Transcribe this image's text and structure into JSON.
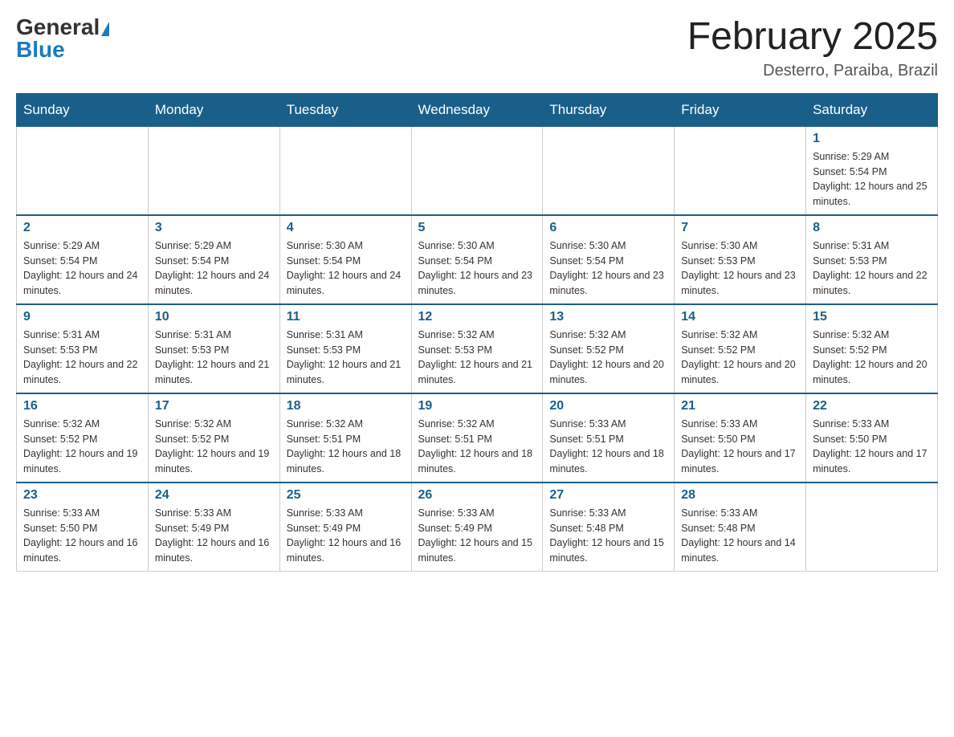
{
  "header": {
    "logo_general": "General",
    "logo_blue": "Blue",
    "title": "February 2025",
    "subtitle": "Desterro, Paraiba, Brazil"
  },
  "days_of_week": [
    "Sunday",
    "Monday",
    "Tuesday",
    "Wednesday",
    "Thursday",
    "Friday",
    "Saturday"
  ],
  "weeks": [
    [
      {
        "day": "",
        "sunrise": "",
        "sunset": "",
        "daylight": ""
      },
      {
        "day": "",
        "sunrise": "",
        "sunset": "",
        "daylight": ""
      },
      {
        "day": "",
        "sunrise": "",
        "sunset": "",
        "daylight": ""
      },
      {
        "day": "",
        "sunrise": "",
        "sunset": "",
        "daylight": ""
      },
      {
        "day": "",
        "sunrise": "",
        "sunset": "",
        "daylight": ""
      },
      {
        "day": "",
        "sunrise": "",
        "sunset": "",
        "daylight": ""
      },
      {
        "day": "1",
        "sunrise": "Sunrise: 5:29 AM",
        "sunset": "Sunset: 5:54 PM",
        "daylight": "Daylight: 12 hours and 25 minutes."
      }
    ],
    [
      {
        "day": "2",
        "sunrise": "Sunrise: 5:29 AM",
        "sunset": "Sunset: 5:54 PM",
        "daylight": "Daylight: 12 hours and 24 minutes."
      },
      {
        "day": "3",
        "sunrise": "Sunrise: 5:29 AM",
        "sunset": "Sunset: 5:54 PM",
        "daylight": "Daylight: 12 hours and 24 minutes."
      },
      {
        "day": "4",
        "sunrise": "Sunrise: 5:30 AM",
        "sunset": "Sunset: 5:54 PM",
        "daylight": "Daylight: 12 hours and 24 minutes."
      },
      {
        "day": "5",
        "sunrise": "Sunrise: 5:30 AM",
        "sunset": "Sunset: 5:54 PM",
        "daylight": "Daylight: 12 hours and 23 minutes."
      },
      {
        "day": "6",
        "sunrise": "Sunrise: 5:30 AM",
        "sunset": "Sunset: 5:54 PM",
        "daylight": "Daylight: 12 hours and 23 minutes."
      },
      {
        "day": "7",
        "sunrise": "Sunrise: 5:30 AM",
        "sunset": "Sunset: 5:53 PM",
        "daylight": "Daylight: 12 hours and 23 minutes."
      },
      {
        "day": "8",
        "sunrise": "Sunrise: 5:31 AM",
        "sunset": "Sunset: 5:53 PM",
        "daylight": "Daylight: 12 hours and 22 minutes."
      }
    ],
    [
      {
        "day": "9",
        "sunrise": "Sunrise: 5:31 AM",
        "sunset": "Sunset: 5:53 PM",
        "daylight": "Daylight: 12 hours and 22 minutes."
      },
      {
        "day": "10",
        "sunrise": "Sunrise: 5:31 AM",
        "sunset": "Sunset: 5:53 PM",
        "daylight": "Daylight: 12 hours and 21 minutes."
      },
      {
        "day": "11",
        "sunrise": "Sunrise: 5:31 AM",
        "sunset": "Sunset: 5:53 PM",
        "daylight": "Daylight: 12 hours and 21 minutes."
      },
      {
        "day": "12",
        "sunrise": "Sunrise: 5:32 AM",
        "sunset": "Sunset: 5:53 PM",
        "daylight": "Daylight: 12 hours and 21 minutes."
      },
      {
        "day": "13",
        "sunrise": "Sunrise: 5:32 AM",
        "sunset": "Sunset: 5:52 PM",
        "daylight": "Daylight: 12 hours and 20 minutes."
      },
      {
        "day": "14",
        "sunrise": "Sunrise: 5:32 AM",
        "sunset": "Sunset: 5:52 PM",
        "daylight": "Daylight: 12 hours and 20 minutes."
      },
      {
        "day": "15",
        "sunrise": "Sunrise: 5:32 AM",
        "sunset": "Sunset: 5:52 PM",
        "daylight": "Daylight: 12 hours and 20 minutes."
      }
    ],
    [
      {
        "day": "16",
        "sunrise": "Sunrise: 5:32 AM",
        "sunset": "Sunset: 5:52 PM",
        "daylight": "Daylight: 12 hours and 19 minutes."
      },
      {
        "day": "17",
        "sunrise": "Sunrise: 5:32 AM",
        "sunset": "Sunset: 5:52 PM",
        "daylight": "Daylight: 12 hours and 19 minutes."
      },
      {
        "day": "18",
        "sunrise": "Sunrise: 5:32 AM",
        "sunset": "Sunset: 5:51 PM",
        "daylight": "Daylight: 12 hours and 18 minutes."
      },
      {
        "day": "19",
        "sunrise": "Sunrise: 5:32 AM",
        "sunset": "Sunset: 5:51 PM",
        "daylight": "Daylight: 12 hours and 18 minutes."
      },
      {
        "day": "20",
        "sunrise": "Sunrise: 5:33 AM",
        "sunset": "Sunset: 5:51 PM",
        "daylight": "Daylight: 12 hours and 18 minutes."
      },
      {
        "day": "21",
        "sunrise": "Sunrise: 5:33 AM",
        "sunset": "Sunset: 5:50 PM",
        "daylight": "Daylight: 12 hours and 17 minutes."
      },
      {
        "day": "22",
        "sunrise": "Sunrise: 5:33 AM",
        "sunset": "Sunset: 5:50 PM",
        "daylight": "Daylight: 12 hours and 17 minutes."
      }
    ],
    [
      {
        "day": "23",
        "sunrise": "Sunrise: 5:33 AM",
        "sunset": "Sunset: 5:50 PM",
        "daylight": "Daylight: 12 hours and 16 minutes."
      },
      {
        "day": "24",
        "sunrise": "Sunrise: 5:33 AM",
        "sunset": "Sunset: 5:49 PM",
        "daylight": "Daylight: 12 hours and 16 minutes."
      },
      {
        "day": "25",
        "sunrise": "Sunrise: 5:33 AM",
        "sunset": "Sunset: 5:49 PM",
        "daylight": "Daylight: 12 hours and 16 minutes."
      },
      {
        "day": "26",
        "sunrise": "Sunrise: 5:33 AM",
        "sunset": "Sunset: 5:49 PM",
        "daylight": "Daylight: 12 hours and 15 minutes."
      },
      {
        "day": "27",
        "sunrise": "Sunrise: 5:33 AM",
        "sunset": "Sunset: 5:48 PM",
        "daylight": "Daylight: 12 hours and 15 minutes."
      },
      {
        "day": "28",
        "sunrise": "Sunrise: 5:33 AM",
        "sunset": "Sunset: 5:48 PM",
        "daylight": "Daylight: 12 hours and 14 minutes."
      },
      {
        "day": "",
        "sunrise": "",
        "sunset": "",
        "daylight": ""
      }
    ]
  ]
}
